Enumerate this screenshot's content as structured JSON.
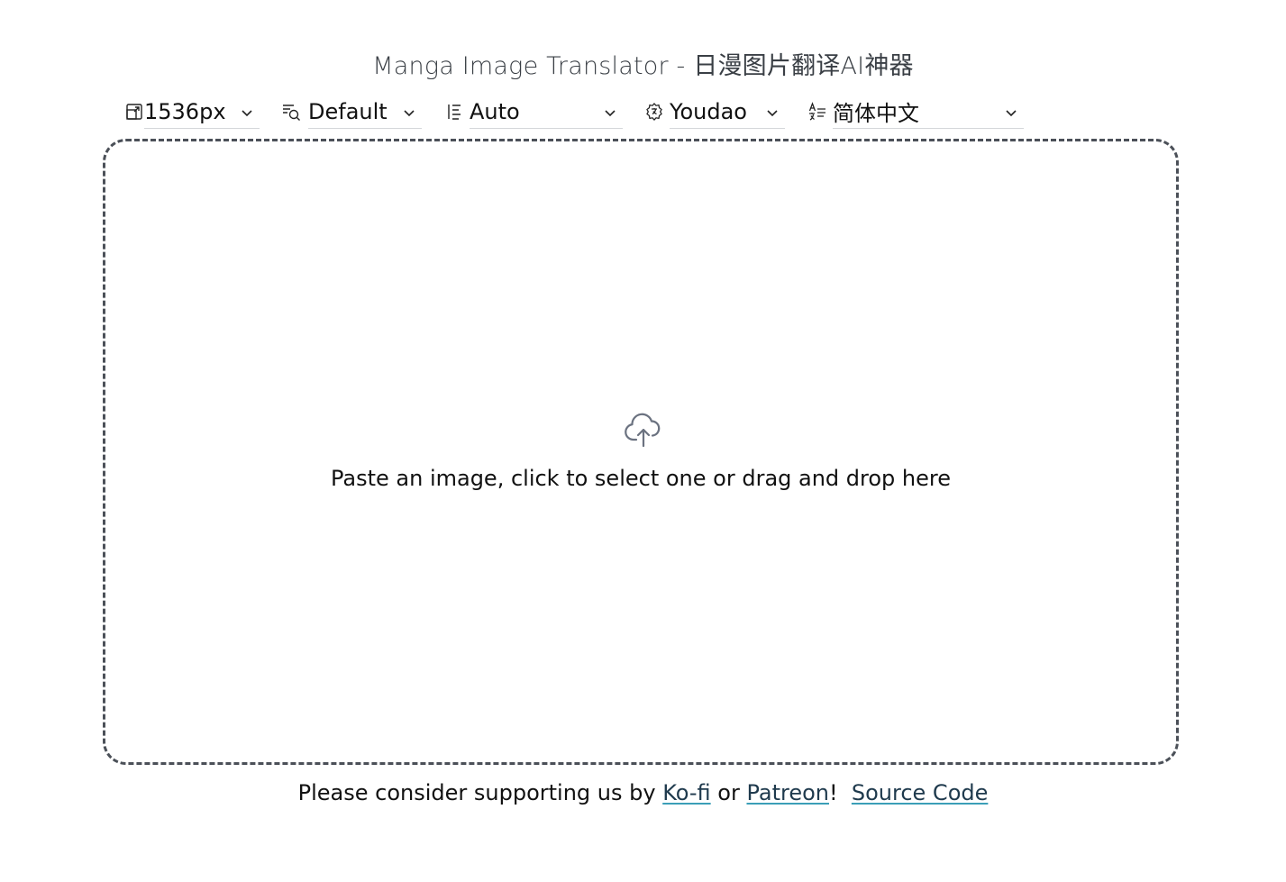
{
  "title": "Manga Image Translator - 日漫图片翻译AI神器",
  "toolbar": {
    "size": {
      "value": "1536px",
      "icon": "resize-icon"
    },
    "detector": {
      "value": "Default",
      "icon": "detection-icon"
    },
    "direction": {
      "value": "Auto",
      "icon": "text-direction-icon"
    },
    "translator": {
      "value": "Youdao",
      "icon": "translator-cog-icon"
    },
    "target_language": {
      "value": "简体中文",
      "icon": "language-icon"
    }
  },
  "dropzone": {
    "text": "Paste an image, click to select one or drag and drop here",
    "icon": "cloud-upload-icon"
  },
  "footer": {
    "prefix": "Please consider supporting us by ",
    "kofi": "Ko-fi",
    "or": " or ",
    "patreon": "Patreon",
    "bang": "!",
    "source_code": "Source Code"
  },
  "colors": {
    "link_underline": "#3b9eb7",
    "border": "#4b5058"
  }
}
